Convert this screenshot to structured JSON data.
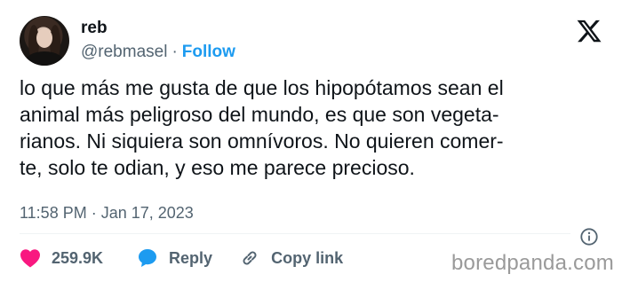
{
  "author": {
    "name": "reb",
    "handle": "@rebmasel",
    "separator": "·",
    "follow_label": "Follow"
  },
  "tweet": {
    "lines": [
      "lo que más me gusta de que los hipopótamos sean el",
      "animal más peligroso del mundo, es que son vegeta-",
      "rianos. Ni siquiera son omnívoros. No quieren comer-",
      "te, solo te odian, y eso me parece precioso."
    ],
    "timestamp": "11:58 PM · Jan 17, 2023"
  },
  "actions": {
    "like_count": "259.9K",
    "reply_label": "Reply",
    "copy_link_label": "Copy link"
  },
  "icons": {
    "logo": "x-logo-icon",
    "info": "info-icon",
    "like": "heart-icon",
    "reply": "speech-bubble-icon",
    "copy": "link-icon"
  },
  "colors": {
    "accent": "#1d9bf0",
    "like": "#f91880",
    "text": "#0f1419",
    "muted": "#536471"
  },
  "watermark": "boredpanda.com"
}
